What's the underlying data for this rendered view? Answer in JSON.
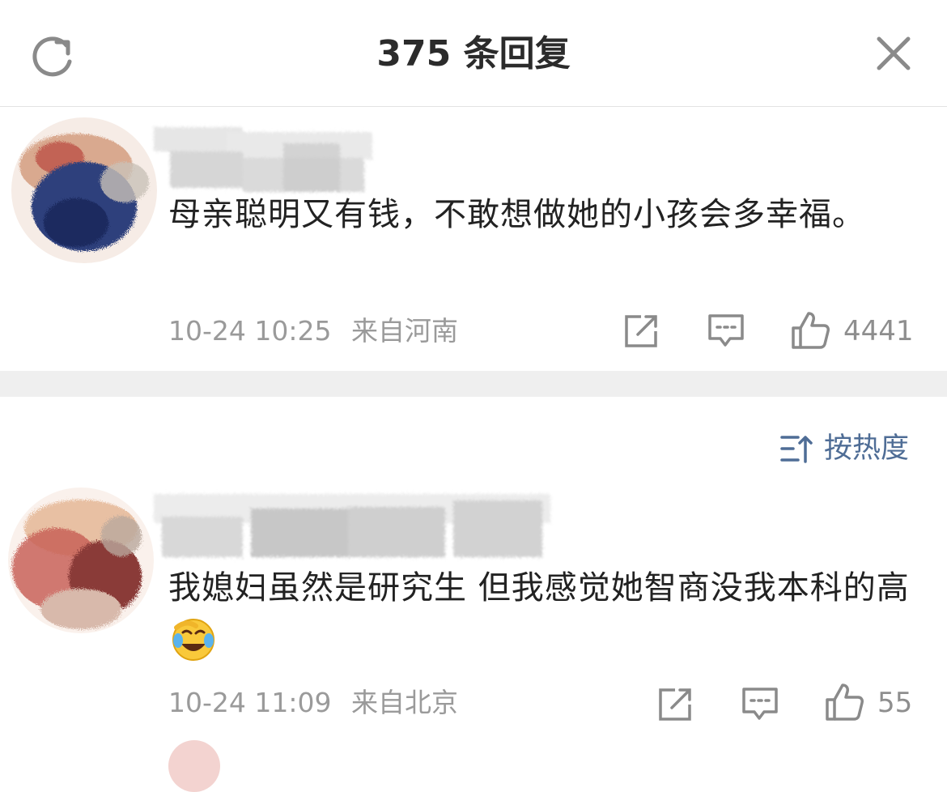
{
  "header": {
    "title": "375 条回复"
  },
  "comments": [
    {
      "text": "母亲聪明又有钱，不敢想做她的小孩会多幸福。",
      "time": "10-24 10:25",
      "location": "来自河南",
      "likes": "4441"
    },
    {
      "text": "我媳妇虽然是研究生 但我感觉她智商没我本科的高",
      "emoji": "laugh-cry-emoji",
      "time": "10-24 11:09",
      "location": "来自北京",
      "likes": "55"
    }
  ],
  "sort": {
    "label": "按热度"
  },
  "icons": {
    "refresh": "refresh-icon",
    "close": "close-icon",
    "share": "share-icon",
    "comment": "comment-icon",
    "like": "thumbs-up-icon",
    "sort": "sort-icon"
  },
  "colors": {
    "accent": "#4f6d96",
    "meta_text": "#9a9a9a",
    "body_text": "#222222",
    "divider": "#efefef"
  }
}
